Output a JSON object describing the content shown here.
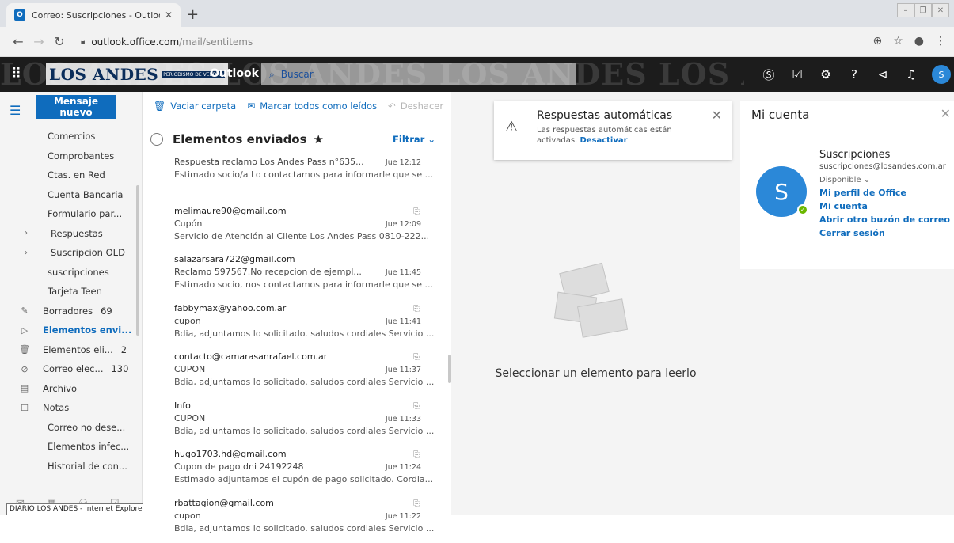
{
  "browser": {
    "tab_title": "Correo: Suscripciones - Outlook",
    "url_host": "outlook.office.com",
    "url_path": "/mail/sentitems"
  },
  "header": {
    "brand": "LOS ANDES",
    "brand_tag": "PERIODISMO DE VERDAD",
    "app": "Outlook",
    "search_placeholder": "Buscar",
    "user_initial": "S"
  },
  "nav": {
    "new_mail": "Mensaje nuevo",
    "folders": [
      {
        "label": "Comercios",
        "count": "",
        "icon": "",
        "kind": "sub"
      },
      {
        "label": "Comprobantes",
        "count": "",
        "icon": "",
        "kind": "sub"
      },
      {
        "label": "Ctas. en Red",
        "count": "",
        "icon": "",
        "kind": "sub"
      },
      {
        "label": "Cuenta Bancaria",
        "count": "",
        "icon": "",
        "kind": "sub"
      },
      {
        "label": "Formulario par...",
        "count": "",
        "icon": "",
        "kind": "sub"
      },
      {
        "label": "Respuestas",
        "count": "",
        "icon": "chevron-right-icon",
        "kind": "exp"
      },
      {
        "label": "Suscripcion OLD",
        "count": "",
        "icon": "chevron-right-icon",
        "kind": "exp"
      },
      {
        "label": "suscripciones",
        "count": "",
        "icon": "",
        "kind": "sub"
      },
      {
        "label": "Tarjeta Teen",
        "count": "",
        "icon": "",
        "kind": "sub"
      },
      {
        "label": "Borradores",
        "count": "69",
        "icon": "pencil-icon",
        "kind": "icon"
      },
      {
        "label": "Elementos envi...",
        "count": "",
        "icon": "send-icon",
        "kind": "icon",
        "active": true
      },
      {
        "label": "Elementos eli...",
        "count": "2",
        "icon": "trash-icon",
        "kind": "icon"
      },
      {
        "label": "Correo elec...",
        "count": "130",
        "icon": "block-icon",
        "kind": "icon"
      },
      {
        "label": "Archivo",
        "count": "",
        "icon": "archive-icon",
        "kind": "icon"
      },
      {
        "label": "Notas",
        "count": "",
        "icon": "note-icon",
        "kind": "icon"
      },
      {
        "label": "Correo no dese...",
        "count": "",
        "icon": "",
        "kind": "sub"
      },
      {
        "label": "Elementos infec...",
        "count": "",
        "icon": "",
        "kind": "sub"
      },
      {
        "label": "Historial de con...",
        "count": "",
        "icon": "",
        "kind": "sub"
      }
    ],
    "ie_tooltip": "DIARIO LOS ANDES - Internet Explorer"
  },
  "toolbar": {
    "empty_folder": "Vaciar carpeta",
    "mark_all_read": "Marcar todos como leídos",
    "undo": "Deshacer"
  },
  "list": {
    "title": "Elementos enviados",
    "filter": "Filtrar",
    "messages": [
      {
        "sender": "",
        "subject": "Respuesta reclamo Los Andes Pass n°635...",
        "time": "Jue 12:12",
        "preview": "Estimado socio/a Lo contactamos para informarle que se ...",
        "attachment": false
      },
      {
        "sender": "melimaure90@gmail.com",
        "subject": "Cupón",
        "time": "Jue 12:09",
        "preview": "Servicio de Atención al Cliente Los Andes Pass 0810-222...",
        "attachment": true
      },
      {
        "sender": "salazarsara722@gmail.com",
        "subject": "Reclamo 597567.No recepcion de ejempl...",
        "time": "Jue 11:45",
        "preview": "Estimado socio, nos contactamos para informarle que se ...",
        "attachment": false
      },
      {
        "sender": "fabbymax@yahoo.com.ar",
        "subject": "cupon",
        "time": "Jue 11:41",
        "preview": "Bdia, adjuntamos lo solicitado. saludos cordiales Servicio ...",
        "attachment": true
      },
      {
        "sender": "contacto@camarasanrafael.com.ar",
        "subject": "CUPON",
        "time": "Jue 11:37",
        "preview": "Bdia, adjuntamos lo solicitado. saludos cordiales Servicio ...",
        "attachment": true
      },
      {
        "sender": "Info",
        "subject": "CUPON",
        "time": "Jue 11:33",
        "preview": "Bdia, adjuntamos lo solicitado. saludos cordiales Servicio ...",
        "attachment": true
      },
      {
        "sender": "hugo1703.hd@gmail.com",
        "subject": "Cupon de pago dni 24192248",
        "time": "Jue 11:24",
        "preview": "Estimado adjuntamos el cupón de pago solicitado. Cordia...",
        "attachment": true
      },
      {
        "sender": "rbattagion@gmail.com",
        "subject": "cupon",
        "time": "Jue 11:22",
        "preview": "Bdia, adjuntamos lo solicitado. saludos cordiales Servicio ...",
        "attachment": true
      }
    ]
  },
  "reading": {
    "auto_title": "Respuestas automáticas",
    "auto_body": "Las respuestas automáticas están activadas.",
    "auto_link": "Desactivar",
    "empty_text": "Seleccionar un elemento para leerlo"
  },
  "account": {
    "title": "Mi cuenta",
    "name": "Suscripciones",
    "email": "suscripciones@losandes.com.ar",
    "status": "Disponible",
    "links": [
      "Mi perfil de Office",
      "Mi cuenta",
      "Abrir otro buzón de correo",
      "Cerrar sesión"
    ],
    "initial": "S"
  },
  "colors": {
    "accent": "#0f6cbd",
    "header_bg": "#1c1c1c",
    "presence": "#6bb700"
  }
}
